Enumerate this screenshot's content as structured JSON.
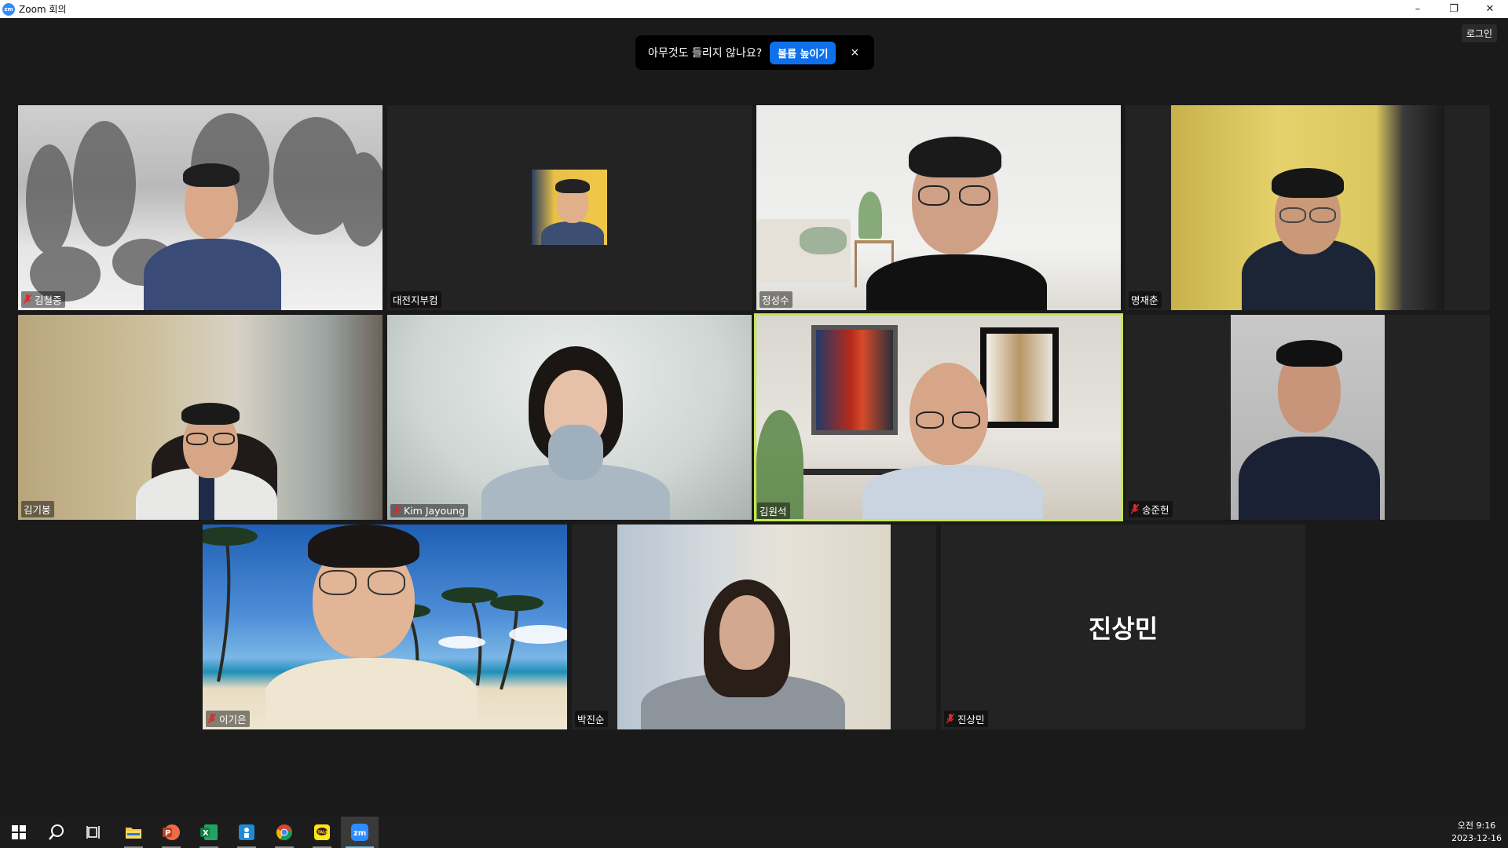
{
  "window": {
    "title": "Zoom 회의",
    "app_icon_text": "zm",
    "minimize": "–",
    "restore": "❐",
    "close": "✕"
  },
  "notice": {
    "message": "아무것도 들리지 않나요?",
    "button": "볼륨 높이기",
    "close": "×"
  },
  "login_button": "로그인",
  "participants": [
    {
      "name": "김철중",
      "muted": true
    },
    {
      "name": "대전지부컴",
      "muted": false
    },
    {
      "name": "정성수",
      "muted": false
    },
    {
      "name": "명재춘",
      "muted": false
    },
    {
      "name": "김기봉",
      "muted": false
    },
    {
      "name": "Kim Jayoung",
      "muted": true
    },
    {
      "name": "김원석",
      "muted": false,
      "active_speaker": true
    },
    {
      "name": "송준헌",
      "muted": true
    },
    {
      "name": "이기은",
      "muted": true
    },
    {
      "name": "박진순",
      "muted": false
    },
    {
      "name": "진상민",
      "muted": true,
      "video_off": true,
      "placeholder": "진상민"
    }
  ],
  "taskbar": {
    "apps": [
      "start-icon",
      "search-icon",
      "task-view-icon",
      "file-explorer-icon",
      "powerpoint-icon",
      "excel-icon",
      "network-app-icon",
      "chrome-icon",
      "kakaotalk-icon",
      "zoom-icon"
    ],
    "clock_time": "오전 9:16",
    "clock_date": "2023-12-16"
  },
  "colors": {
    "accent_blue": "#0e71eb",
    "active_speaker": "#c6e84a",
    "muted_red": "#e02828",
    "background": "#1a1a1a"
  }
}
